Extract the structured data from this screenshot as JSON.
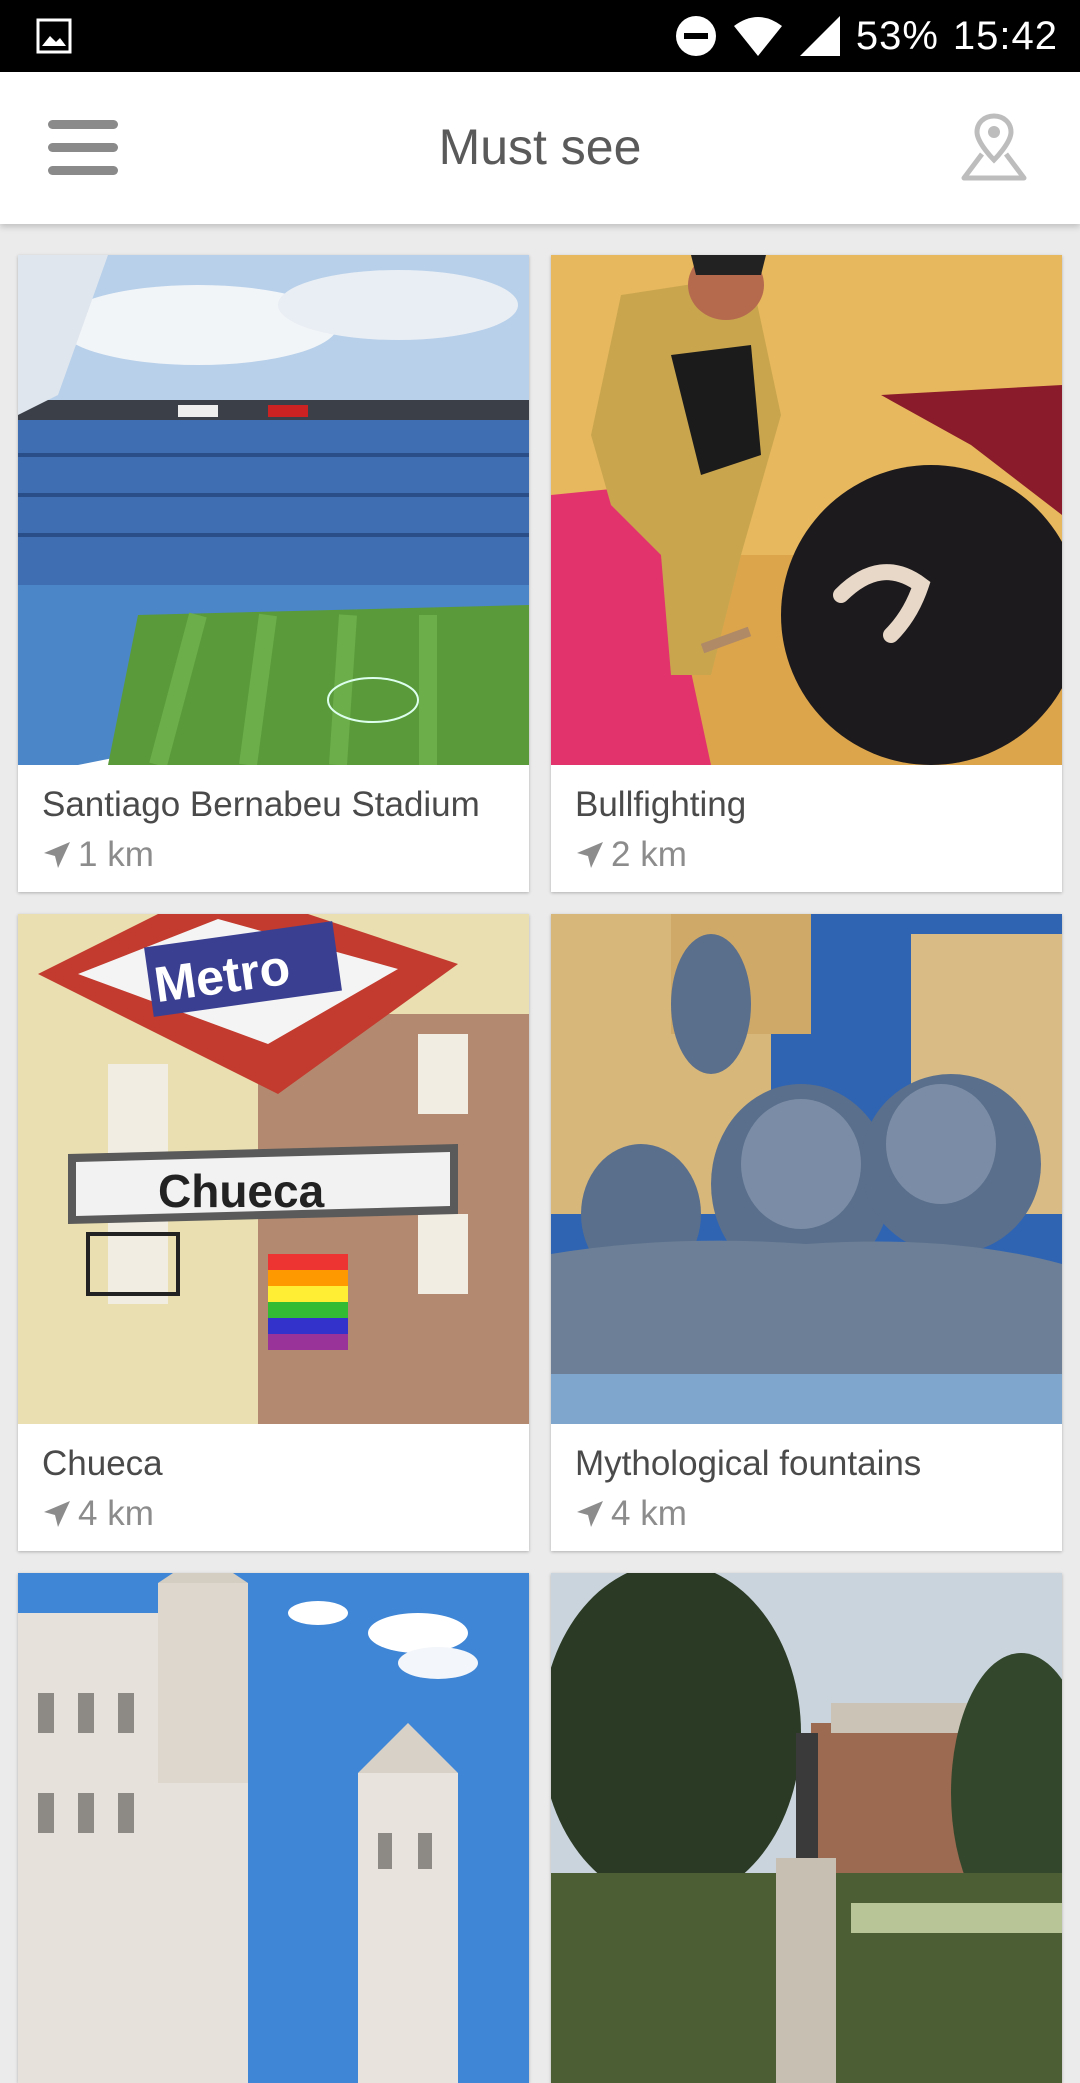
{
  "status_bar": {
    "battery": "53%",
    "time": "15:42",
    "icons": [
      "image-icon",
      "do-not-disturb-icon",
      "wifi-icon",
      "signal-icon"
    ]
  },
  "app_bar": {
    "title": "Must see",
    "menu_icon": "hamburger-menu-icon",
    "map_icon": "map-pin-icon"
  },
  "places": [
    {
      "name": "Santiago Bernabeu Stadium",
      "distance": "1 km",
      "image": "stadium"
    },
    {
      "name": "Bullfighting",
      "distance": "2 km",
      "image": "matador-and-bull"
    },
    {
      "name": "Chueca",
      "distance": "4 km",
      "image": "metro-chueca-sign"
    },
    {
      "name": "Mythological fountains",
      "distance": "4 km",
      "image": "lion-fountain"
    },
    {
      "name": "",
      "distance": "",
      "image": "white-palace"
    },
    {
      "name": "",
      "distance": "",
      "image": "park-statue"
    }
  ],
  "colors": {
    "status_bar_bg": "#000000",
    "app_bar_bg": "#ffffff",
    "page_bg": "#ebebeb",
    "title_text": "#5a5a5a",
    "card_text": "#4a4a4a",
    "distance_text": "#8c8c8c"
  }
}
